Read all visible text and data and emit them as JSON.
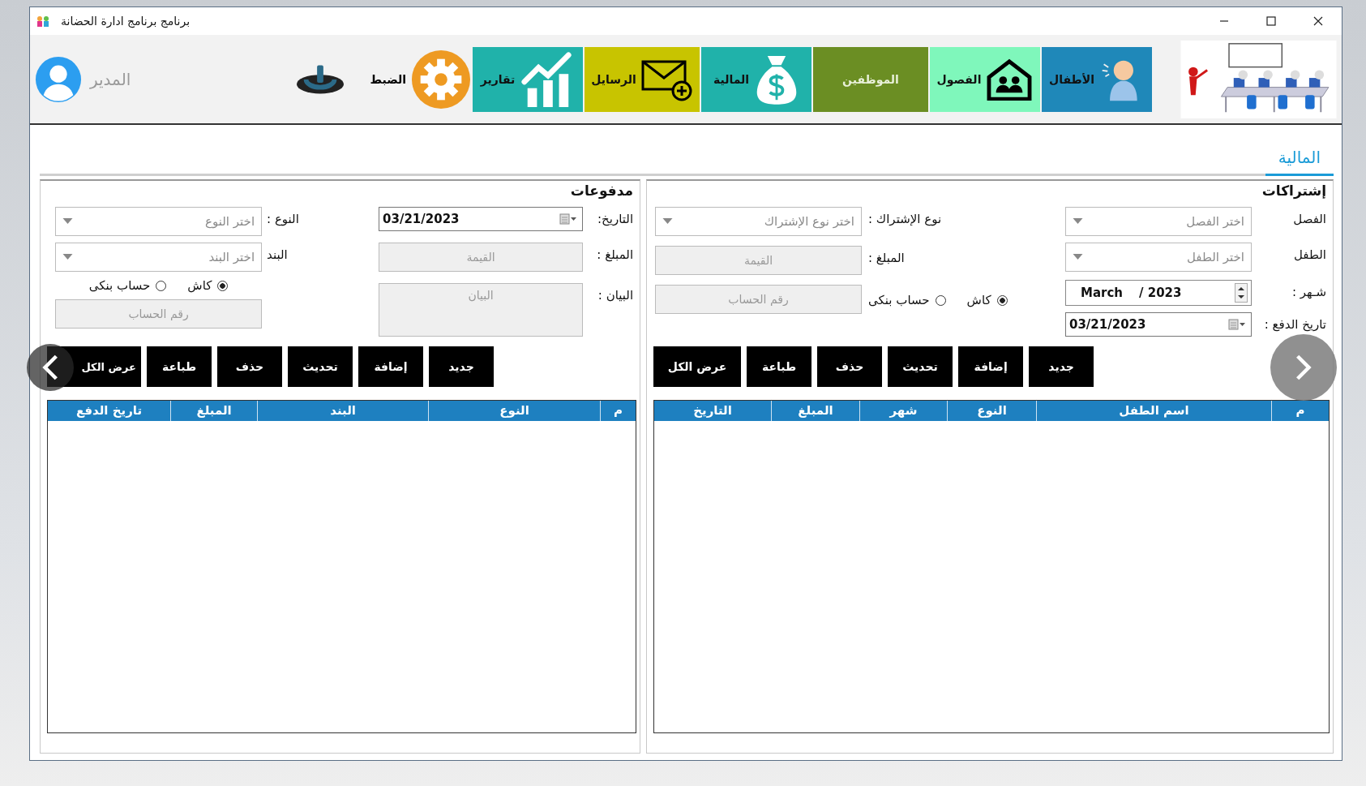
{
  "window": {
    "title": "برنامج  برنامج ادارة الحضانة"
  },
  "toolbar": {
    "tiles": [
      {
        "kind": "children",
        "label": "الأطفال",
        "color": "#1f88b9"
      },
      {
        "kind": "classes",
        "label": "الفصول",
        "color": "#7ff7bb"
      },
      {
        "kind": "staff",
        "label": "الموظفين",
        "color": "#6b8e23"
      },
      {
        "kind": "finance",
        "label": "المالية",
        "color": "#20b2aa"
      },
      {
        "kind": "messages",
        "label": "الرسايل",
        "color": "#c8c400"
      },
      {
        "kind": "reports",
        "label": "تقارير",
        "color": "#20b2aa"
      }
    ],
    "settings": "الضبط",
    "user": "المدير"
  },
  "tabs": [
    {
      "label": "المالية",
      "selected": true
    }
  ],
  "panels": [
    {
      "kind": "subscriptions",
      "title": "إشتراكات",
      "columns": [
        [
          {
            "kind": "field",
            "label": "الفصل",
            "control": {
              "kind": "dropdown",
              "placeholder": "اختر الفصل"
            }
          },
          {
            "kind": "field",
            "label": "الطفل",
            "control": {
              "kind": "dropdown",
              "placeholder": "اختر الطفل"
            }
          },
          {
            "kind": "field",
            "label": "شـهر :",
            "control": {
              "kind": "month",
              "month": "March",
              "separator": "/",
              "year": "2023"
            }
          },
          {
            "kind": "field",
            "label": "تاريخ الدفع :",
            "control": {
              "kind": "date",
              "value": "03/21/2023"
            }
          }
        ],
        [
          {
            "kind": "field",
            "label": "نوع الإشتراك :",
            "control": {
              "kind": "dropdown",
              "placeholder": "اختر نوع الإشتراك"
            }
          },
          {
            "kind": "field",
            "label": "المبلغ :",
            "control": {
              "kind": "textbox",
              "placeholder": "القيمة"
            }
          },
          {
            "kind": "radios_field",
            "radios": [
              {
                "label": "كاش",
                "selected": true
              },
              {
                "label": "حساب بنكى",
                "selected": false
              }
            ],
            "control": {
              "kind": "textbox",
              "placeholder": "رقم الحساب"
            }
          }
        ]
      ],
      "buttons": [
        "جديد",
        "إضافة",
        "تحديث",
        "حذف",
        "طباعة",
        "عرض الكل"
      ],
      "table": {
        "columns": [
          "م",
          "اسم الطفل",
          "النوع",
          "شهر",
          "المبلغ",
          "التاريخ"
        ]
      }
    },
    {
      "kind": "payments",
      "title": "مدفوعات",
      "columns": [
        [
          {
            "kind": "field",
            "label": "التاريخ:",
            "control": {
              "kind": "date",
              "value": "03/21/2023"
            }
          },
          {
            "kind": "field",
            "label": "المبلغ :",
            "control": {
              "kind": "textbox",
              "placeholder": "القيمة"
            }
          },
          {
            "kind": "field",
            "label": "البيان :",
            "control": {
              "kind": "textarea",
              "placeholder": "البيان"
            }
          }
        ],
        [
          {
            "kind": "field",
            "label": "النوع :",
            "control": {
              "kind": "dropdown",
              "placeholder": "اختر النوع"
            }
          },
          {
            "kind": "field",
            "label": "البند",
            "control": {
              "kind": "dropdown",
              "placeholder": "اختر البند"
            }
          },
          {
            "kind": "radios",
            "radios": [
              {
                "label": "كاش",
                "selected": true
              },
              {
                "label": "حساب بنكى",
                "selected": false
              }
            ]
          },
          {
            "kind": "control",
            "control": {
              "kind": "textbox",
              "placeholder": "رقم الحساب"
            }
          }
        ]
      ],
      "buttons": [
        "جديد",
        "إضافة",
        "تحديث",
        "حذف",
        "طباعة",
        "عرض الكل"
      ],
      "table": {
        "columns": [
          "م",
          "النوع",
          "البند",
          "المبلغ",
          "تاريخ الدفع"
        ]
      }
    }
  ]
}
